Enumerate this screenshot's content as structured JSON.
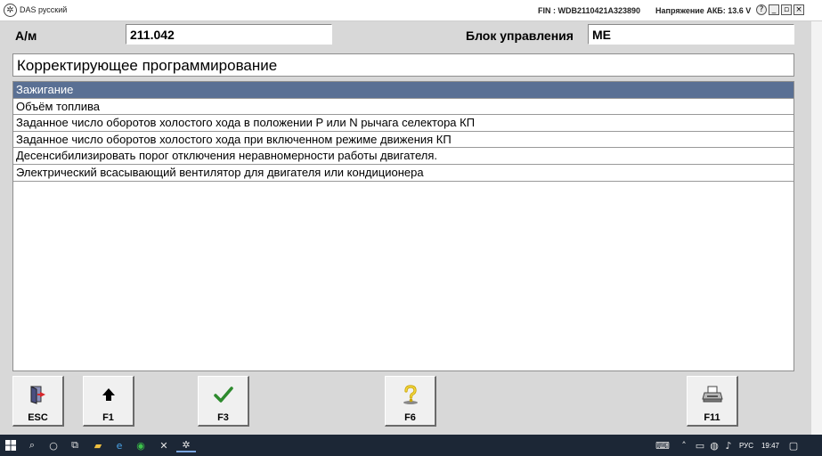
{
  "window": {
    "title": "DAS русский",
    "fin": "FIN : WDB2110421A323890",
    "voltage": "Напряжение АКБ: 13.6 V",
    "buttons": {
      "help": "?",
      "minimize": "_",
      "restore": "▫",
      "close": "×"
    }
  },
  "header": {
    "model_label": "А/м",
    "model_value": "211.042",
    "ecu_label": "Блок управления",
    "ecu_value": "ME"
  },
  "screen": {
    "title": "Корректирующее программирование"
  },
  "list": {
    "items": [
      "Зажигание",
      "Объём топлива",
      "Заданное число оборотов холостого хода в положении P или N рычага селектора КП",
      "Заданное число оборотов холостого хода при включенном режиме движения КП",
      "Десенсибилизировать порог отключения неравномерности работы двигателя.",
      "Электрический всасывающий вентилятор для двигателя или кондиционера"
    ],
    "selected_index": 0
  },
  "function_keys": [
    {
      "key": "ESC",
      "icon": "exit-door-icon"
    },
    {
      "key": "F1",
      "icon": "arrow-up-icon"
    },
    {
      "key": "F3",
      "icon": "checkmark-icon"
    },
    {
      "key": "F6",
      "icon": "help-question-icon"
    },
    {
      "key": "F11",
      "icon": "printer-icon"
    }
  ],
  "taskbar": {
    "language": "РУС",
    "time": "19:47"
  },
  "colors": {
    "selection": "#5a7094",
    "background": "#d8d8d8",
    "check_green": "#2d8a2d",
    "taskbar": "#1c2736"
  }
}
